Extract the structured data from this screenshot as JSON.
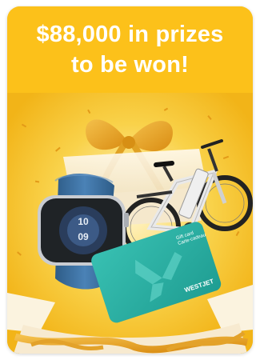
{
  "promo": {
    "headline_line1": "$88,000 in prizes",
    "headline_line2": "to be won!",
    "prizes": [
      "smartwatch",
      "electric-bike",
      "gift-card"
    ],
    "gift_card": {
      "label_en": "Gift card",
      "label_fr": "Carte-cadeau",
      "brand": "WESTJET"
    },
    "colors": {
      "background": "#fcc11a",
      "headline_text": "#ffffff",
      "gift_card": "#2ab3a6",
      "ribbon": "#e8a21c",
      "watch_band": "#3c6e9c"
    }
  }
}
